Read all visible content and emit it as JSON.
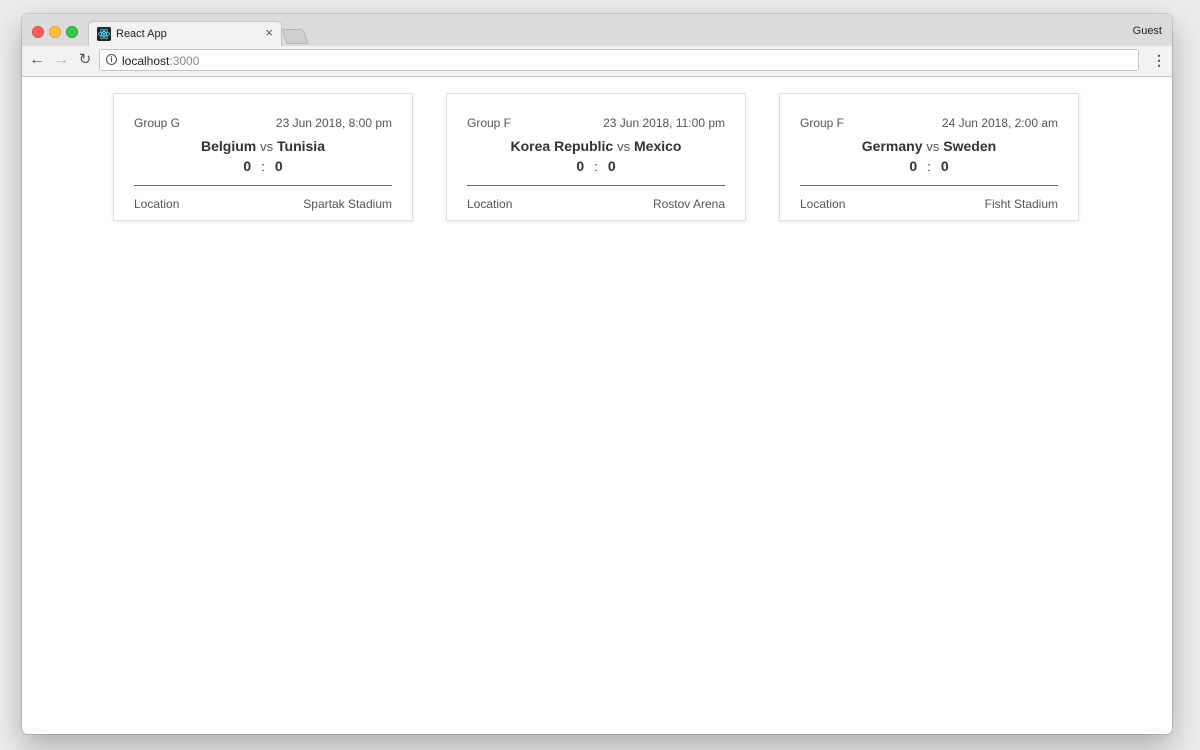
{
  "browser": {
    "tab_title": "React App",
    "tab_close": "×",
    "profile": "Guest",
    "url_host": "localhost",
    "url_port": ":3000",
    "icons": {
      "back": "back-arrow-icon",
      "forward": "forward-arrow-icon",
      "reload": "reload-icon",
      "info": "info-icon",
      "menu": "kebab-menu-icon"
    }
  },
  "matches": [
    {
      "group": "Group G",
      "datetime": "23 Jun 2018, 8:00 pm",
      "home": "Belgium",
      "vs": "vs",
      "away": "Tunisia",
      "home_score": "0",
      "sep": ":",
      "away_score": "0",
      "location_label": "Location",
      "location": "Spartak Stadium"
    },
    {
      "group": "Group F",
      "datetime": "23 Jun 2018, 11:00 pm",
      "home": "Korea Republic",
      "vs": "vs",
      "away": "Mexico",
      "home_score": "0",
      "sep": ":",
      "away_score": "0",
      "location_label": "Location",
      "location": "Rostov Arena"
    },
    {
      "group": "Group F",
      "datetime": "24 Jun 2018, 2:00 am",
      "home": "Germany",
      "vs": "vs",
      "away": "Sweden",
      "home_score": "0",
      "sep": ":",
      "away_score": "0",
      "location_label": "Location",
      "location": "Fisht Stadium"
    }
  ]
}
